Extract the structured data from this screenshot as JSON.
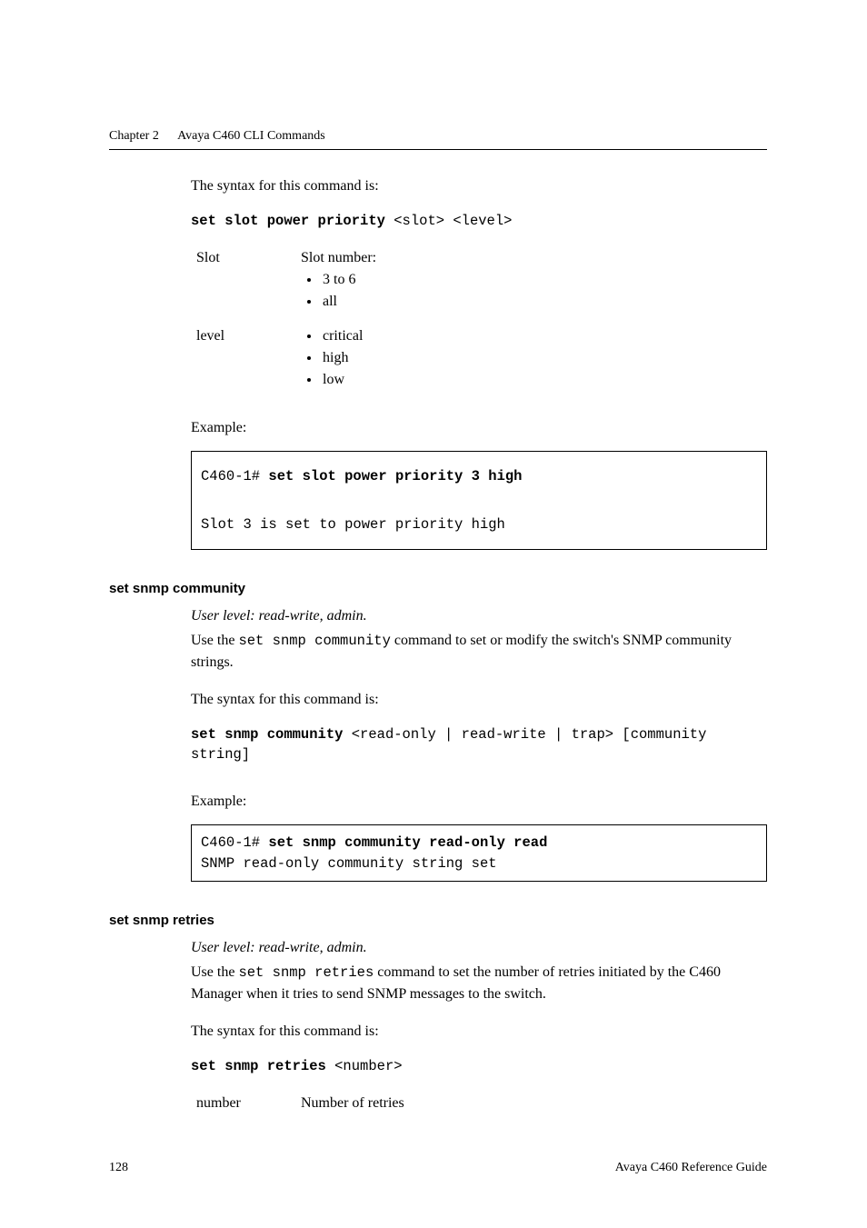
{
  "header": {
    "chapter": "Chapter 2",
    "title": "Avaya C460 CLI Commands"
  },
  "section1": {
    "syntax_intro": "The syntax for this command is:",
    "cmd_bold": "set slot power priority",
    "cmd_args": " <slot> <level>",
    "params": {
      "slot_key": "Slot",
      "slot_intro": "Slot number:",
      "slot_b1": "3 to 6",
      "slot_b2": "all",
      "level_key": "level",
      "level_b1": "critical",
      "level_b2": "high",
      "level_b3": "low"
    },
    "example_label": "Example:",
    "codebox_line1_prompt": "C460-1# ",
    "codebox_line1_cmd": "set slot power priority 3 high",
    "codebox_line2": "Slot 3 is set to power priority high"
  },
  "section2": {
    "heading": "set snmp community",
    "userlevel": "User level: read-write, admin.",
    "desc_pre": "Use the ",
    "desc_code": "set snmp community",
    "desc_post": " command to set or modify the switch's SNMP community strings.",
    "syntax_intro": "The syntax for this command is:",
    "cmd_bold": "set snmp community",
    "cmd_args": " <read-only | read-write | trap> [community string]",
    "example_label": "Example:",
    "codebox_line1_prompt": "C460-1# ",
    "codebox_line1_cmd": "set snmp community read-only read",
    "codebox_line2": "SNMP read-only community string set"
  },
  "section3": {
    "heading": "set snmp retries",
    "userlevel": "User level: read-write, admin.",
    "desc_pre": "Use the ",
    "desc_code": "set snmp retries",
    "desc_post": " command to set the number of retries initiated by the C460 Manager when it tries to send SNMP messages to the switch.",
    "syntax_intro": "The syntax for this command is:",
    "cmd_bold": "set snmp retries",
    "cmd_args": " <number>",
    "param_key": "number",
    "param_val": "Number of retries"
  },
  "footer": {
    "page": "128",
    "doc": "Avaya C460 Reference Guide"
  }
}
